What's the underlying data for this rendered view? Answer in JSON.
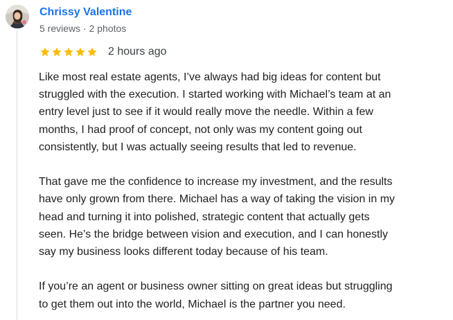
{
  "review": {
    "author": {
      "name": "Chrissy Valentine",
      "meta": "5 reviews · 2 photos"
    },
    "rating": {
      "stars": 5,
      "max": 5,
      "star_color": "#fbbc04"
    },
    "time": "2 hours ago",
    "paragraphs": [
      "Like most real estate agents, I’ve always had big ideas for content but\nstruggled with the execution. I started working with Michael’s team at an\nentry level just to see if it would really move the needle. Within a few\nmonths, I had proof of concept, not only was my content going out\nconsistently, but I was actually seeing results that led to revenue.",
      "That gave me the confidence to increase my investment, and the results\nhave only grown from there. Michael has a way of taking the vision in my\nhead and turning it into polished, strategic content that actually gets\nseen. He’s the bridge between vision and execution, and I can honestly\nsay my business looks different today because of his team.",
      "If you’re an agent or business owner sitting on great ideas but struggling\nto get them out into the world, Michael is the partner you need."
    ]
  },
  "colors": {
    "link": "#1a73e8",
    "meta": "#5f6368",
    "text": "#202124"
  }
}
